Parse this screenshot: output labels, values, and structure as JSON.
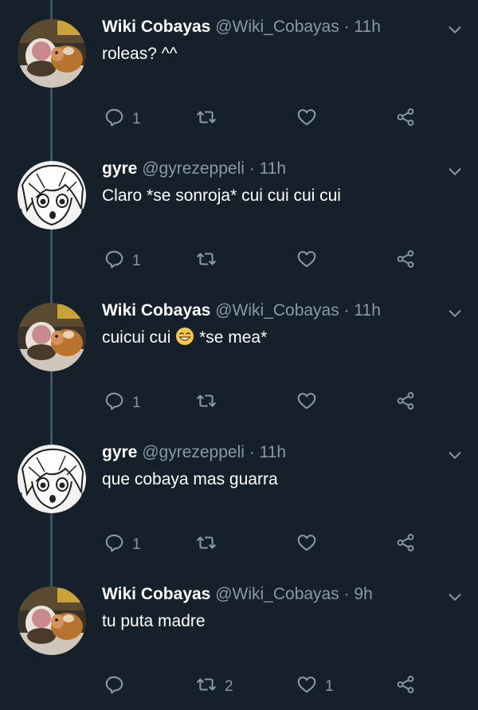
{
  "tweets": [
    {
      "name": "Wiki Cobayas",
      "handle": "@Wiki_Cobayas",
      "dot": "·",
      "time": "11h",
      "text": "roleas? ^^",
      "text_after_emoji": "",
      "has_emoji": false,
      "avatar": "guinea-pig",
      "reply_count": "1",
      "retweet_count": "",
      "like_count": ""
    },
    {
      "name": "gyre",
      "handle": "@gyrezeppeli",
      "dot": "·",
      "time": "11h",
      "text": "Claro *se sonroja* cui cui cui cui",
      "text_after_emoji": "",
      "has_emoji": false,
      "avatar": "manga-face",
      "reply_count": "1",
      "retweet_count": "",
      "like_count": ""
    },
    {
      "name": "Wiki Cobayas",
      "handle": "@Wiki_Cobayas",
      "dot": "·",
      "time": "11h",
      "text": "cuicui cui",
      "text_after_emoji": "*se mea*",
      "has_emoji": true,
      "emoji": "grinning-sweat-face",
      "avatar": "guinea-pig",
      "reply_count": "1",
      "retweet_count": "",
      "like_count": ""
    },
    {
      "name": "gyre",
      "handle": "@gyrezeppeli",
      "dot": "·",
      "time": "11h",
      "text": "que cobaya mas guarra",
      "text_after_emoji": "",
      "has_emoji": false,
      "avatar": "manga-face",
      "reply_count": "1",
      "retweet_count": "",
      "like_count": ""
    },
    {
      "name": "Wiki Cobayas",
      "handle": "@Wiki_Cobayas",
      "dot": "·",
      "time": "9h",
      "text": "tu puta madre",
      "text_after_emoji": "",
      "has_emoji": false,
      "avatar": "guinea-pig",
      "reply_count": "",
      "retweet_count": "2",
      "like_count": "1"
    }
  ],
  "colors": {
    "background": "#15202b",
    "text": "#ffffff",
    "secondary": "#8899a6",
    "thread_line": "#3d5466"
  },
  "icons": {
    "reply": "speech-bubble-icon",
    "retweet": "retweet-arrows-icon",
    "like": "heart-icon",
    "share": "share-nodes-icon",
    "menu": "chevron-down-icon"
  }
}
